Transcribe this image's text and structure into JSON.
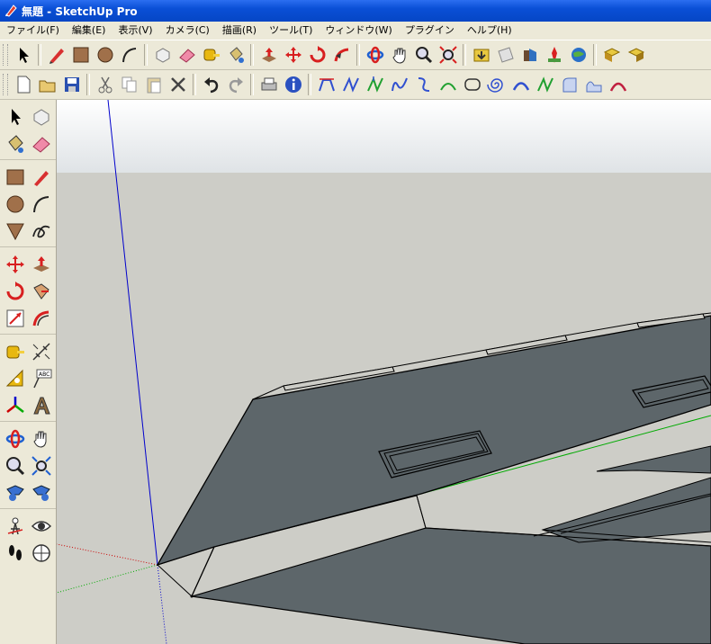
{
  "window": {
    "title": "無題 - SketchUp Pro"
  },
  "menu": [
    {
      "label": "ファイル(F)"
    },
    {
      "label": "編集(E)"
    },
    {
      "label": "表示(V)"
    },
    {
      "label": "カメラ(C)"
    },
    {
      "label": "描画(R)"
    },
    {
      "label": "ツール(T)"
    },
    {
      "label": "ウィンドウ(W)"
    },
    {
      "label": "プラグイン"
    },
    {
      "label": "ヘルプ(H)"
    }
  ],
  "toolbar1": [
    "select-icon",
    "pencil-icon",
    "rectangle-icon",
    "circle-icon",
    "arc-icon",
    "make-component-icon",
    "eraser-icon",
    "tape-measure-icon",
    "paint-bucket-icon",
    "push-pull-icon",
    "move-icon",
    "rotate-icon",
    "follow-me-icon",
    "orbit-icon",
    "pan-icon",
    "zoom-icon",
    "zoom-extents-icon",
    "get-models-icon",
    "share-model-icon",
    "photo-textures-icon",
    "add-location-icon",
    "google-earth-icon",
    "share-component-icon",
    "get-components-icon"
  ],
  "toolbar2": [
    "new-file-icon",
    "open-file-icon",
    "save-icon",
    "cut-icon",
    "copy-icon",
    "paste-icon",
    "delete-icon",
    "undo-icon",
    "redo-icon",
    "print-icon",
    "model-info-icon",
    "curve-tool-icon",
    "curve-tool-icon",
    "curve-tool-icon",
    "curve-tool-icon",
    "curve-tool-icon",
    "curve-tool-icon",
    "curve-tool-icon",
    "curve-tool-icon",
    "curve-tool-icon",
    "curve-tool-icon",
    "curve-tool-icon",
    "curve-tool-icon",
    "curve-tool-icon"
  ],
  "lefttoolbar": [
    [
      "select-icon",
      "make-component-icon"
    ],
    [
      "paint-bucket-icon",
      "eraser-icon"
    ],
    [
      "rectangle-icon",
      "line-icon"
    ],
    [
      "circle-icon",
      "arc-icon"
    ],
    [
      "polygon-icon",
      "freehand-icon"
    ],
    [
      "move-icon",
      "push-pull-icon"
    ],
    [
      "rotate-icon",
      "follow-me-icon"
    ],
    [
      "scale-icon",
      "offset-icon"
    ],
    [
      "tape-measure-icon",
      "dimension-icon"
    ],
    [
      "protractor-icon",
      "text-icon"
    ],
    [
      "axes-icon",
      "3d-text-icon"
    ],
    [
      "orbit-icon",
      "pan-icon"
    ],
    [
      "zoom-icon",
      "zoom-window-icon"
    ],
    [
      "zoom-extents-icon",
      "previous-view-icon"
    ],
    [
      "position-camera-icon",
      "look-around-icon"
    ],
    [
      "walk-icon",
      "section-plane-icon"
    ]
  ],
  "colors": {
    "title_bar": "#0a4fd6",
    "sky": "#e9eef1",
    "ground": "#cdcdc7",
    "face": "#5d666a",
    "edge": "#000000",
    "axis_red": "#cc0000",
    "axis_green": "#00aa00",
    "axis_blue": "#0000cc"
  }
}
